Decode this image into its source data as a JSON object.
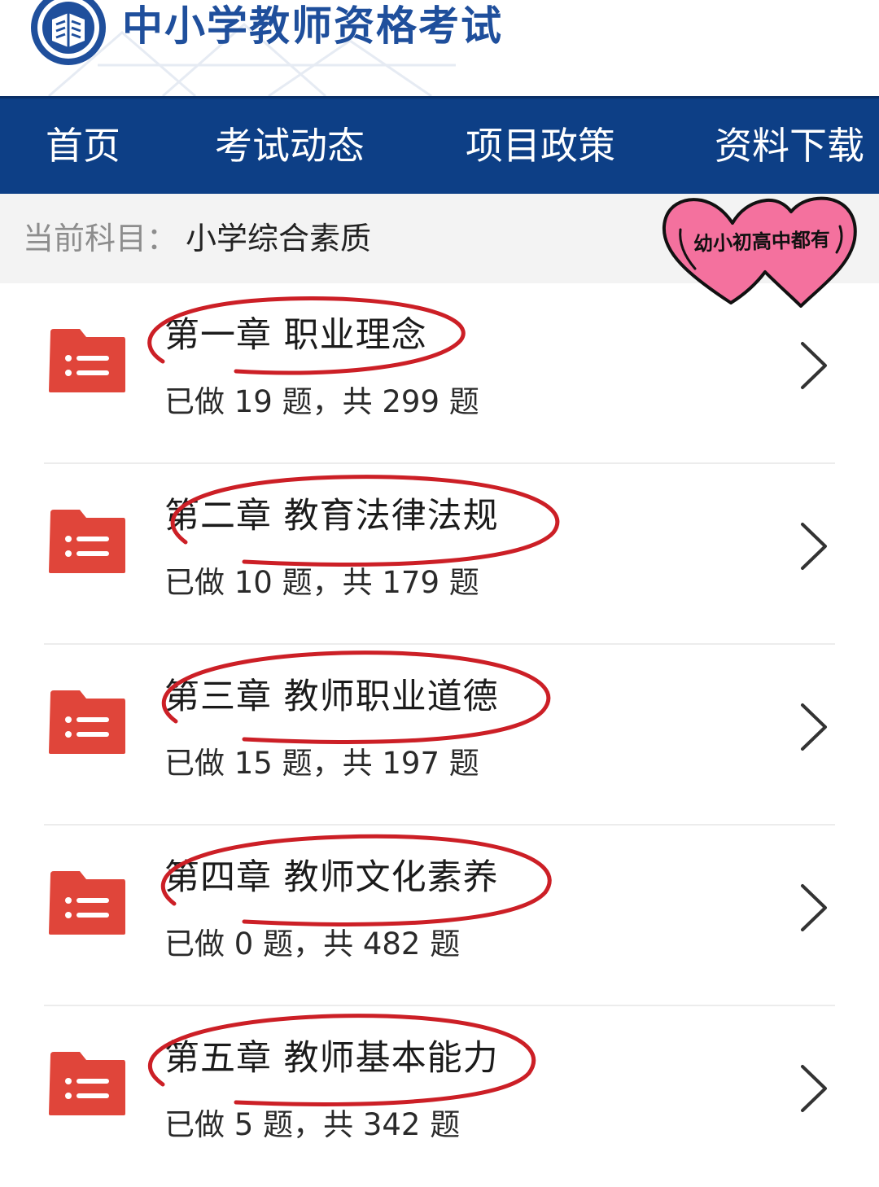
{
  "header": {
    "site_title": "中小学教师资格考试",
    "logo_icon": "book-emblem-icon"
  },
  "nav": {
    "items": [
      {
        "label": "首页"
      },
      {
        "label": "考试动态"
      },
      {
        "label": "项目政策"
      },
      {
        "label": "资料下载"
      }
    ]
  },
  "subject": {
    "label": "当前科目：",
    "value": "小学综合素质"
  },
  "sticker": {
    "text": "幼小初高中都有"
  },
  "chapters": [
    {
      "title": "第一章  职业理念",
      "stats": "已做 19 题，共 299 题"
    },
    {
      "title": "第二章  教育法律法规",
      "stats": "已做 10 题，共 179 题"
    },
    {
      "title": "第三章  教师职业道德",
      "stats": "已做 15 题，共 197 题"
    },
    {
      "title": "第四章  教师文化素养",
      "stats": "已做 0 题，共 482 题"
    },
    {
      "title": "第五章  教师基本能力",
      "stats": "已做 5 题，共 342 题"
    }
  ],
  "colors": {
    "nav_bg": "#0d3f86",
    "title_blue": "#1f4f9c",
    "folder_red": "#e0453a",
    "circle_red": "#cc1f26",
    "heart_pink": "#f4719e"
  }
}
